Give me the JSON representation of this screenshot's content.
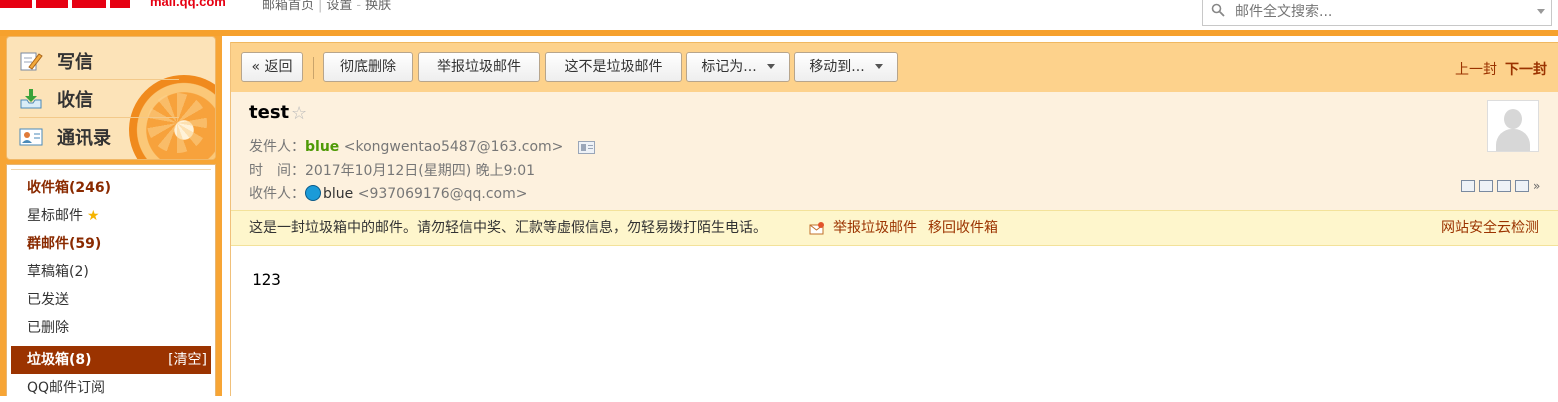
{
  "header": {
    "logo_domain": "mail.qq.com",
    "links": [
      "邮箱首页",
      "设置",
      "换肤"
    ],
    "search_placeholder": "邮件全文搜索..."
  },
  "sidebar": {
    "actions": [
      "写信",
      "收信",
      "通讯录"
    ],
    "folders": [
      {
        "label": "收件箱(246)"
      },
      {
        "label": "星标邮件"
      },
      {
        "label": "群邮件(59)"
      },
      {
        "label": "草稿箱(2)"
      },
      {
        "label": "已发送"
      },
      {
        "label": "已删除"
      },
      {
        "label": "垃圾箱(8)",
        "extra": "[清空]"
      },
      {
        "label": "QQ邮件订阅"
      }
    ]
  },
  "toolbar": {
    "back": "« 返回",
    "delete_permanently": "彻底删除",
    "report_spam": "举报垃圾邮件",
    "not_spam": "这不是垃圾邮件",
    "mark_as": "标记为...",
    "move_to": "移动到...",
    "prev": "上一封",
    "next": "下一封"
  },
  "mail": {
    "subject": "test",
    "from_label": "发件人：",
    "from_name": "blue",
    "from_addr": "<kongwentao5487@163.com>",
    "time_label": "时　间：",
    "time_value": "2017年10月12日(星期四) 晚上9:01",
    "to_label": "收件人：",
    "to_name": "blue",
    "to_addr": "<937069176@qq.com>",
    "body": "123"
  },
  "spam_notice": {
    "message": "这是一封垃圾箱中的邮件。请勿轻信中奖、汇款等虚假信息，勿轻易拨打陌生电话。",
    "report": "举报垃圾邮件",
    "move_back": "移回收件箱",
    "security_check": "网站安全云检测"
  },
  "colors": {
    "accent_orange": "#f6a12d",
    "active_folder": "#9b3300",
    "link": "#9b3300",
    "sender_green": "#4e9a06"
  }
}
